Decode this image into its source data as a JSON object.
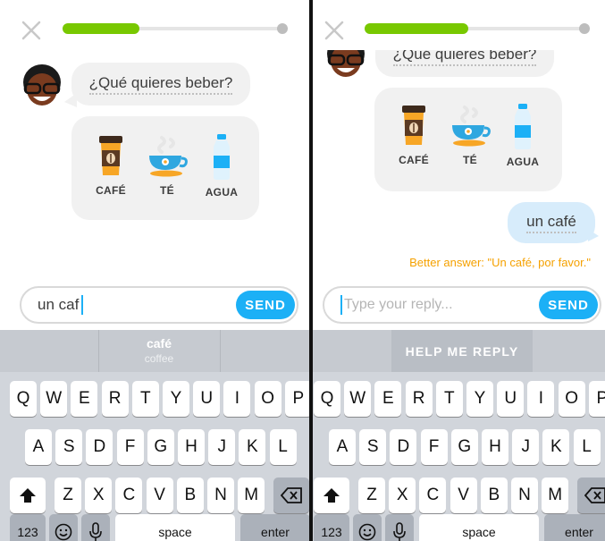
{
  "left": {
    "progress_fraction": 0.35,
    "prompt": "¿Qué quieres beber?",
    "choices": [
      {
        "label": "CAFÉ",
        "icon": "coffee-cup-icon"
      },
      {
        "label": "TÉ",
        "icon": "tea-cup-icon"
      },
      {
        "label": "AGUA",
        "icon": "water-bottle-icon"
      }
    ],
    "input_value": "un caf",
    "send_label": "SEND",
    "suggestion": {
      "word": "café",
      "translation": "coffee"
    }
  },
  "right": {
    "progress_fraction": 0.47,
    "prompt": "¿Qué quieres beber?",
    "choices": [
      {
        "label": "CAFÉ",
        "icon": "coffee-cup-icon"
      },
      {
        "label": "TÉ",
        "icon": "tea-cup-icon"
      },
      {
        "label": "AGUA",
        "icon": "water-bottle-icon"
      }
    ],
    "user_reply": "un café",
    "better_answer": "Better answer: \"Un café, por favor.\"",
    "input_placeholder": "Type your reply...",
    "send_label": "SEND",
    "help_label": "HELP ME REPLY"
  },
  "keyboard": {
    "row1": [
      "Q",
      "W",
      "E",
      "R",
      "T",
      "Y",
      "U",
      "I",
      "O",
      "P"
    ],
    "row2": [
      "A",
      "S",
      "D",
      "F",
      "G",
      "H",
      "J",
      "K",
      "L"
    ],
    "row3": [
      "Z",
      "X",
      "C",
      "V",
      "B",
      "N",
      "M"
    ],
    "numbers_key": "123",
    "space_key": "space",
    "enter_key": "enter"
  },
  "colors": {
    "progress_green": "#78c800",
    "send_blue": "#1cb0f6",
    "better_answer_orange": "#f5a100",
    "reply_bubble": "#d7ecfb"
  }
}
